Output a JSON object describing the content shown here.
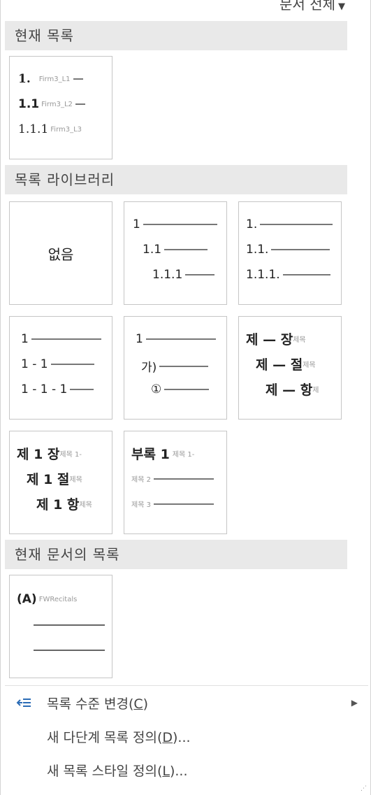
{
  "scope_dropdown": {
    "label": "문서 전체",
    "caret": "▼"
  },
  "sections": {
    "current_list": "현재 목록",
    "library": "목록 라이브러리",
    "document_lists": "현재 문서의 목록"
  },
  "current_list_tile": {
    "rows": [
      {
        "num": "1.",
        "label": "Firm3_L1"
      },
      {
        "num": "1.1",
        "label": "Firm3_L2"
      },
      {
        "num": "1.1.1",
        "label": "Firm3_L3"
      }
    ]
  },
  "library": {
    "none_label": "없음",
    "tile2": [
      "1",
      "1.1",
      "1.1.1"
    ],
    "tile3": [
      "1.",
      "1.1.",
      "1.1.1."
    ],
    "tile4": [
      "1",
      "1 - 1",
      "1 - 1 - 1"
    ],
    "tile5": [
      "1",
      "가)",
      "①"
    ],
    "tile6": [
      {
        "main": "제 — 장",
        "small": "제목"
      },
      {
        "main": "제 — 절",
        "small": "제목"
      },
      {
        "main": "제 — 항",
        "small": "제"
      }
    ],
    "tile7": [
      {
        "main": "제 1 장",
        "small": "제목 1-"
      },
      {
        "main": "제 1 절",
        "small": "제목"
      },
      {
        "main": "제 1 항",
        "small": "제목"
      }
    ],
    "tile8": {
      "main": "부록 1",
      "small1": "제목 1-",
      "row2": "제목 2",
      "row3": "제목 3"
    }
  },
  "document_list_tile": {
    "num": "(A)",
    "label": "FWRecitals"
  },
  "menu": {
    "change_level": {
      "text": "목록 수준 변경(",
      "key": "C",
      "end": ")"
    },
    "define_multilevel": {
      "text": "새 다단계 목록 정의(",
      "key": "D",
      "end": ")..."
    },
    "define_style": {
      "text": "새 목록 스타일 정의(",
      "key": "L",
      "end": ")..."
    }
  },
  "icons": {
    "change_level": "indent-arrows-icon",
    "submenu": "chevron-right-icon"
  }
}
